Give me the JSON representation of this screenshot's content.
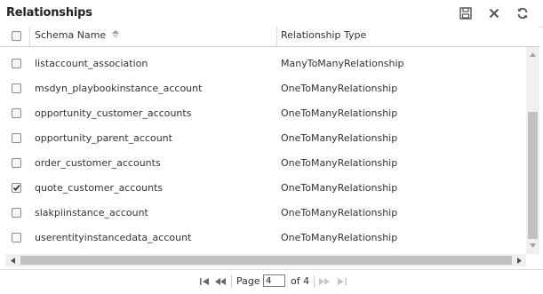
{
  "panel": {
    "title": "Relationships",
    "icons": [
      "save-icon",
      "close-icon",
      "refresh-icon"
    ]
  },
  "columns": {
    "schema_name": "Schema Name",
    "sort_indicator": "ascending",
    "relationship_type": "Relationship Type"
  },
  "rows": [
    {
      "name": "listaccount_association",
      "type": "ManyToManyRelationship",
      "checked": false
    },
    {
      "name": "msdyn_playbookinstance_account",
      "type": "OneToManyRelationship",
      "checked": false
    },
    {
      "name": "opportunity_customer_accounts",
      "type": "OneToManyRelationship",
      "checked": false
    },
    {
      "name": "opportunity_parent_account",
      "type": "OneToManyRelationship",
      "checked": false
    },
    {
      "name": "order_customer_accounts",
      "type": "OneToManyRelationship",
      "checked": false
    },
    {
      "name": "quote_customer_accounts",
      "type": "OneToManyRelationship",
      "checked": true
    },
    {
      "name": "slakpiinstance_account",
      "type": "OneToManyRelationship",
      "checked": false
    },
    {
      "name": "userentityinstancedata_account",
      "type": "OneToManyRelationship",
      "checked": false
    }
  ],
  "pager": {
    "page_label": "Page",
    "current_page": "4",
    "of_label": "of 4",
    "icons": [
      "first-page-icon",
      "previous-page-icon",
      "next-page-icon",
      "last-page-icon"
    ]
  },
  "colors": {
    "scroll_track": "#f0f0f0",
    "scroll_thumb": "#c1c1c1",
    "border": "#d8d8d8"
  }
}
